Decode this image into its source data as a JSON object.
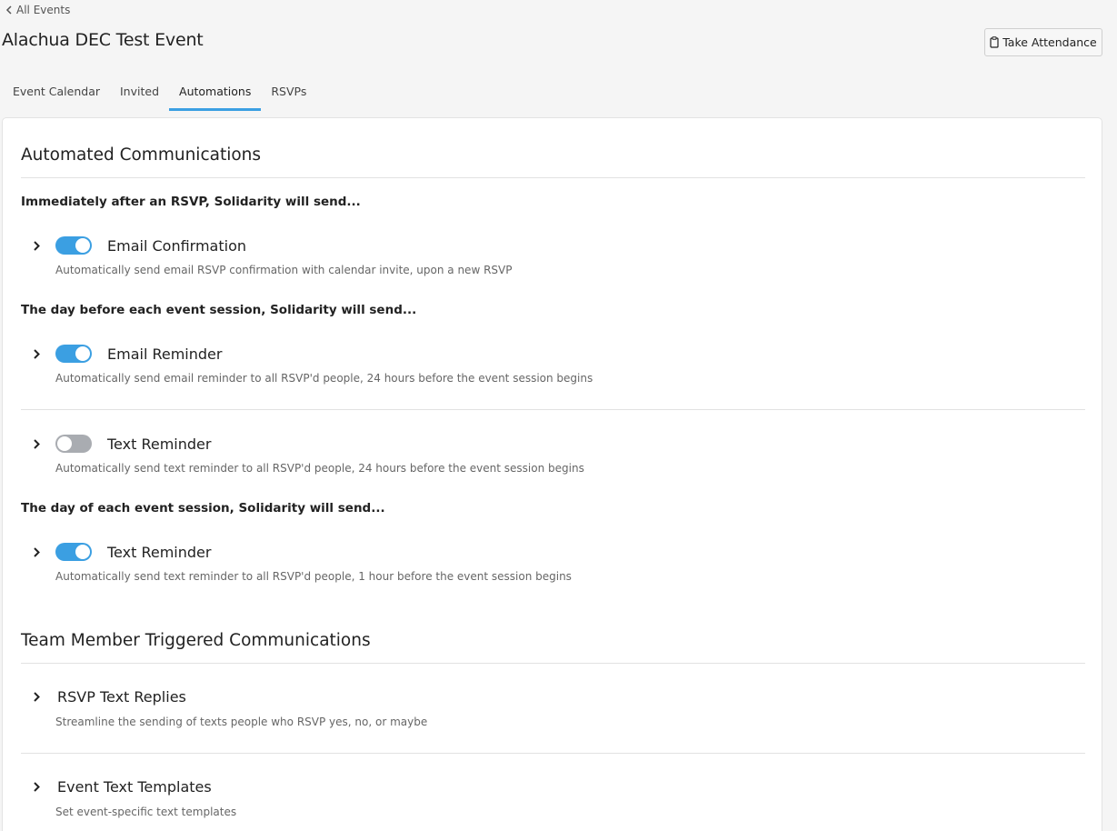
{
  "header": {
    "back_label": "All Events",
    "title": "Alachua DEC Test Event",
    "attendance_button": "Take Attendance"
  },
  "tabs": [
    {
      "label": "Event Calendar",
      "active": false
    },
    {
      "label": "Invited",
      "active": false
    },
    {
      "label": "Automations",
      "active": true
    },
    {
      "label": "RSVPs",
      "active": false
    }
  ],
  "automated": {
    "title": "Automated Communications",
    "group1_label": "Immediately after an RSVP, Solidarity will send...",
    "group2_label": "The day before each event session, Solidarity will send...",
    "group3_label": "The day of each event session, Solidarity will send...",
    "items": [
      {
        "title": "Email Confirmation",
        "enabled": true,
        "description": "Automatically send email RSVP confirmation with calendar invite, upon a new RSVP"
      },
      {
        "title": "Email Reminder",
        "enabled": true,
        "description": "Automatically send email reminder to all RSVP'd people, 24 hours before the event session begins"
      },
      {
        "title": "Text Reminder",
        "enabled": false,
        "description": "Automatically send text reminder to all RSVP'd people, 24 hours before the event session begins"
      },
      {
        "title": "Text Reminder",
        "enabled": true,
        "description": "Automatically send text reminder to all RSVP'd people, 1 hour before the event session begins"
      }
    ]
  },
  "triggered": {
    "title": "Team Member Triggered Communications",
    "items": [
      {
        "title": "RSVP Text Replies",
        "description": "Streamline the sending of texts people who RSVP yes, no, or maybe"
      },
      {
        "title": "Event Text Templates",
        "description": "Set event-specific text templates"
      }
    ]
  },
  "colors": {
    "accent": "#3b9fe2",
    "toggle_off": "#a9acb1",
    "background": "#f5f5f5"
  }
}
